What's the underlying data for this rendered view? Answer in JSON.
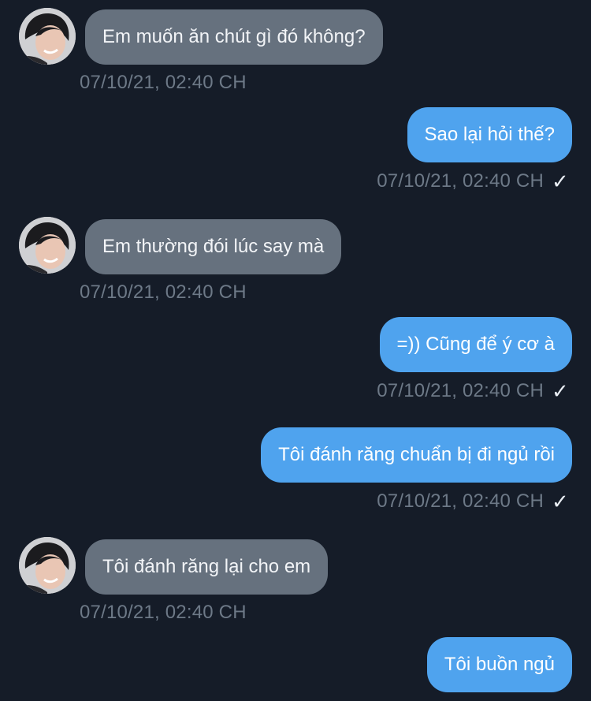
{
  "chat": {
    "messages": [
      {
        "direction": "in",
        "text": "Em muốn ăn chút gì đó không?",
        "time": "07/10/21, 02:40 CH"
      },
      {
        "direction": "out",
        "text": "Sao lại hỏi thế?",
        "time": "07/10/21, 02:40 CH",
        "status_icon": "✓"
      },
      {
        "direction": "in",
        "text": "Em thường đói lúc say mà",
        "time": "07/10/21, 02:40 CH"
      },
      {
        "direction": "out",
        "text": "=)) Cũng để ý cơ à",
        "time": "07/10/21, 02:40 CH",
        "status_icon": "✓"
      },
      {
        "direction": "out",
        "text": "Tôi đánh răng chuẩn bị đi ngủ rồi",
        "time": "07/10/21, 02:40 CH",
        "status_icon": "✓"
      },
      {
        "direction": "in",
        "text": "Tôi đánh răng lại cho em",
        "time": "07/10/21, 02:40 CH"
      },
      {
        "direction": "out",
        "text": "Tôi buồn ngủ"
      }
    ]
  },
  "colors": {
    "background": "#151c28",
    "incoming_bubble": "#66717e",
    "outgoing_bubble": "#4fa3ee",
    "timestamp": "#6d7987"
  },
  "icons": {
    "avatar": "contact-avatar-photo",
    "read_receipt": "check-icon"
  }
}
